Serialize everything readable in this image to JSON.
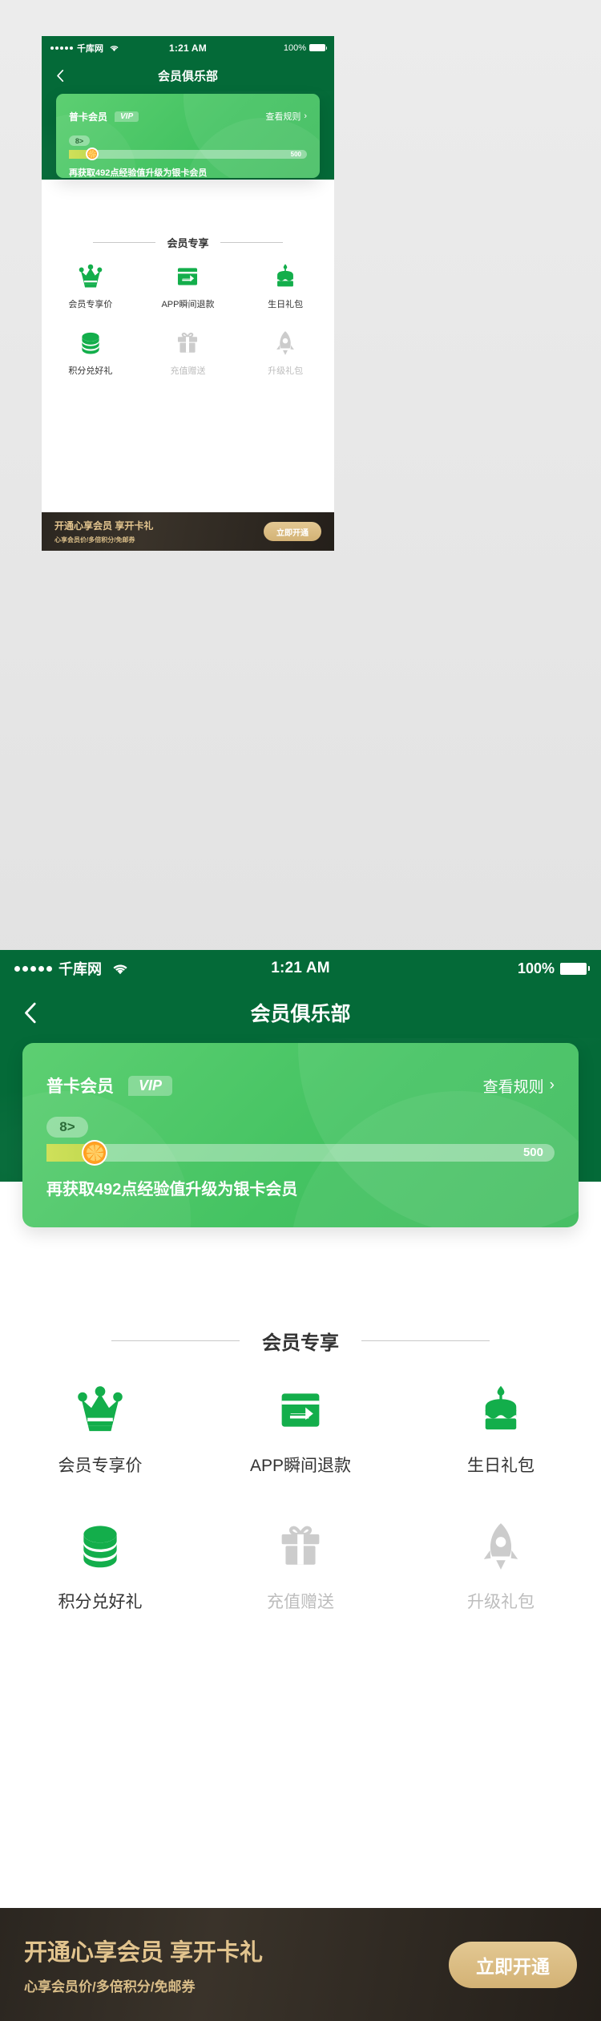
{
  "statusbar": {
    "carrier": "千库网",
    "time": "1:21 AM",
    "battery": "100%",
    "signal_dots": 5,
    "wifi_icon": "wifi-icon",
    "battery_icon": "battery-full-icon"
  },
  "navbar": {
    "title": "会员俱乐部",
    "back_icon": "chevron-left-icon"
  },
  "vip_card": {
    "tier_label": "普卡会员",
    "vip_badge": "VIP",
    "rules_link": "查看规则",
    "rules_chevron_icon": "chevron-right-icon",
    "level_badge": "8>",
    "progress_current": 8,
    "progress_max_label": "500",
    "progress_max": 500,
    "progress_percent": 1.6,
    "marker_icon": "orange-slice-icon",
    "note": "再获取492点经验值升级为银卡会员"
  },
  "section": {
    "title": "会员专享"
  },
  "benefits": [
    {
      "label": "会员专享价",
      "icon": "crown-icon",
      "enabled": true
    },
    {
      "label": "APP瞬间退款",
      "icon": "refund-card-icon",
      "enabled": true
    },
    {
      "label": "生日礼包",
      "icon": "birthday-cake-icon",
      "enabled": true
    },
    {
      "label": "积分兑好礼",
      "icon": "coins-stack-icon",
      "enabled": true
    },
    {
      "label": "充值赠送",
      "icon": "gift-box-icon",
      "enabled": false
    },
    {
      "label": "升级礼包",
      "icon": "rocket-icon",
      "enabled": false
    }
  ],
  "banner": {
    "title": "开通心享会员  享开卡礼",
    "subtitle": "心享会员价/多倍积分/免邮券",
    "button": "立即开通"
  },
  "colors": {
    "header_green": "#046A38",
    "card_green": "#44C362",
    "icon_green": "#13AE4B",
    "icon_disabled": "#cccccc",
    "banner_gold": "#E2C48E",
    "progress_fill": "#CFE05A",
    "marker_orange": "#FF9A1E"
  }
}
